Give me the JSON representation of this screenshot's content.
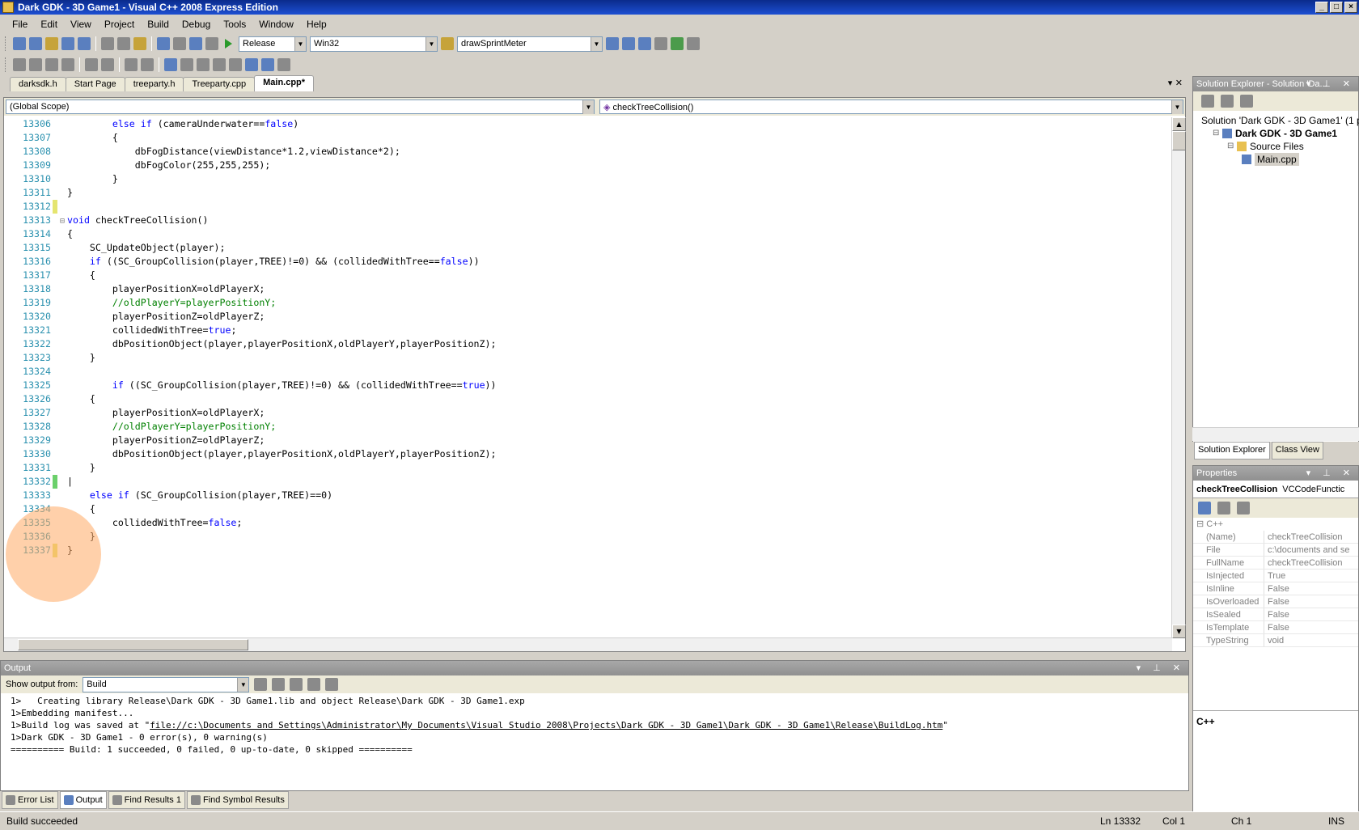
{
  "window": {
    "title": "Dark GDK - 3D Game1 - Visual C++ 2008 Express Edition"
  },
  "menu": [
    "File",
    "Edit",
    "View",
    "Project",
    "Build",
    "Debug",
    "Tools",
    "Window",
    "Help"
  ],
  "toolbar": {
    "config": "Release",
    "platform": "Win32",
    "find": "drawSprintMeter"
  },
  "tabs": [
    "darksdk.h",
    "Start Page",
    "treeparty.h",
    "Treeparty.cpp",
    "Main.cpp*"
  ],
  "editor": {
    "scope": "(Global Scope)",
    "member": "checkTreeCollision()",
    "lines": [
      {
        "n": "13306",
        "marg": "",
        "fold": "",
        "tokens": [
          [
            "",
            "        "
          ],
          [
            "kw",
            "else if"
          ],
          [
            "",
            " (cameraUnderwater=="
          ],
          [
            "kw",
            "false"
          ],
          [
            "",
            ")"
          ]
        ]
      },
      {
        "n": "13307",
        "marg": "",
        "fold": "",
        "tokens": [
          [
            "",
            "        {"
          ]
        ]
      },
      {
        "n": "13308",
        "marg": "",
        "fold": "",
        "tokens": [
          [
            "",
            "            dbFogDistance(viewDistance*1.2,viewDistance*2);"
          ]
        ]
      },
      {
        "n": "13309",
        "marg": "",
        "fold": "",
        "tokens": [
          [
            "",
            "            dbFogColor(255,255,255);"
          ]
        ]
      },
      {
        "n": "13310",
        "marg": "",
        "fold": "",
        "tokens": [
          [
            "",
            "        }"
          ]
        ]
      },
      {
        "n": "13311",
        "marg": "",
        "fold": "",
        "tokens": [
          [
            "",
            "}"
          ]
        ]
      },
      {
        "n": "13312",
        "marg": "y",
        "fold": "",
        "tokens": [
          [
            "",
            ""
          ]
        ]
      },
      {
        "n": "13313",
        "marg": "",
        "fold": "⊟",
        "tokens": [
          [
            "kw",
            "void"
          ],
          [
            "",
            " checkTreeCollision()"
          ]
        ]
      },
      {
        "n": "13314",
        "marg": "",
        "fold": "",
        "tokens": [
          [
            "",
            "{"
          ]
        ]
      },
      {
        "n": "13315",
        "marg": "",
        "fold": "",
        "tokens": [
          [
            "",
            "    SC_UpdateObject(player);"
          ]
        ]
      },
      {
        "n": "13316",
        "marg": "",
        "fold": "",
        "tokens": [
          [
            "",
            "    "
          ],
          [
            "kw",
            "if"
          ],
          [
            "",
            " ((SC_GroupCollision(player,TREE)!=0) && (collidedWithTree=="
          ],
          [
            "kw",
            "false"
          ],
          [
            "",
            "))"
          ]
        ]
      },
      {
        "n": "13317",
        "marg": "",
        "fold": "",
        "tokens": [
          [
            "",
            "    {"
          ]
        ]
      },
      {
        "n": "13318",
        "marg": "",
        "fold": "",
        "tokens": [
          [
            "",
            "        playerPositionX=oldPlayerX;"
          ]
        ]
      },
      {
        "n": "13319",
        "marg": "",
        "fold": "",
        "tokens": [
          [
            "",
            "        "
          ],
          [
            "cm",
            "//oldPlayerY=playerPositionY;"
          ]
        ]
      },
      {
        "n": "13320",
        "marg": "",
        "fold": "",
        "tokens": [
          [
            "",
            "        playerPositionZ=oldPlayerZ;"
          ]
        ]
      },
      {
        "n": "13321",
        "marg": "",
        "fold": "",
        "tokens": [
          [
            "",
            "        collidedWithTree="
          ],
          [
            "kw",
            "true"
          ],
          [
            "",
            ";"
          ]
        ]
      },
      {
        "n": "13322",
        "marg": "",
        "fold": "",
        "tokens": [
          [
            "",
            "        dbPositionObject(player,playerPositionX,oldPlayerY,playerPositionZ);"
          ]
        ]
      },
      {
        "n": "13323",
        "marg": "",
        "fold": "",
        "tokens": [
          [
            "",
            "    }"
          ]
        ]
      },
      {
        "n": "13324",
        "marg": "",
        "fold": "",
        "tokens": [
          [
            "",
            ""
          ]
        ]
      },
      {
        "n": "13325",
        "marg": "",
        "fold": "",
        "tokens": [
          [
            "",
            "        "
          ],
          [
            "kw",
            "if"
          ],
          [
            "",
            " ((SC_GroupCollision(player,TREE)!=0) && (collidedWithTree=="
          ],
          [
            "kw",
            "true"
          ],
          [
            "",
            "))"
          ]
        ]
      },
      {
        "n": "13326",
        "marg": "",
        "fold": "",
        "tokens": [
          [
            "",
            "    {"
          ]
        ]
      },
      {
        "n": "13327",
        "marg": "",
        "fold": "",
        "tokens": [
          [
            "",
            "        playerPositionX=oldPlayerX;"
          ]
        ]
      },
      {
        "n": "13328",
        "marg": "",
        "fold": "",
        "tokens": [
          [
            "",
            "        "
          ],
          [
            "cm",
            "//oldPlayerY=playerPositionY;"
          ]
        ]
      },
      {
        "n": "13329",
        "marg": "",
        "fold": "",
        "tokens": [
          [
            "",
            "        playerPositionZ=oldPlayerZ;"
          ]
        ]
      },
      {
        "n": "13330",
        "marg": "",
        "fold": "",
        "tokens": [
          [
            "",
            "        dbPositionObject(player,playerPositionX,oldPlayerY,playerPositionZ);"
          ]
        ]
      },
      {
        "n": "13331",
        "marg": "",
        "fold": "",
        "tokens": [
          [
            "",
            "    }"
          ]
        ]
      },
      {
        "n": "13332",
        "marg": "g",
        "fold": "",
        "tokens": [
          [
            "",
            "|"
          ]
        ]
      },
      {
        "n": "13333",
        "marg": "",
        "fold": "",
        "tokens": [
          [
            "",
            "    "
          ],
          [
            "kw",
            "else if"
          ],
          [
            "",
            " (SC_GroupCollision(player,TREE)==0)"
          ]
        ]
      },
      {
        "n": "13334",
        "marg": "",
        "fold": "",
        "tokens": [
          [
            "",
            "    {"
          ]
        ]
      },
      {
        "n": "13335",
        "marg": "",
        "fold": "",
        "tokens": [
          [
            "",
            "        collidedWithTree="
          ],
          [
            "kw",
            "false"
          ],
          [
            "",
            ";"
          ]
        ]
      },
      {
        "n": "13336",
        "marg": "",
        "fold": "",
        "tokens": [
          [
            "",
            "    }"
          ]
        ]
      },
      {
        "n": "13337",
        "marg": "y",
        "fold": "",
        "tokens": [
          [
            "",
            "}"
          ]
        ]
      }
    ]
  },
  "solution_explorer": {
    "title": "Solution Explorer - Solution 'Da...",
    "items": [
      {
        "label": "Solution 'Dark GDK - 3D Game1' (1 p",
        "indent": 0,
        "bold": false,
        "sel": false
      },
      {
        "label": "Dark GDK - 3D Game1",
        "indent": 1,
        "bold": true,
        "sel": false
      },
      {
        "label": "Source Files",
        "indent": 2,
        "bold": false,
        "sel": false
      },
      {
        "label": "Main.cpp",
        "indent": 3,
        "bold": false,
        "sel": true
      }
    ],
    "tabs": [
      "Solution Explorer",
      "Class View"
    ]
  },
  "properties": {
    "title": "Properties",
    "object_name": "checkTreeCollision",
    "object_type": "VCCodeFunctic",
    "category": "C++",
    "rows": [
      {
        "k": "(Name)",
        "v": "checkTreeCollision"
      },
      {
        "k": "File",
        "v": "c:\\documents and se"
      },
      {
        "k": "FullName",
        "v": "checkTreeCollision"
      },
      {
        "k": "IsInjected",
        "v": "True"
      },
      {
        "k": "IsInline",
        "v": "False"
      },
      {
        "k": "IsOverloaded",
        "v": "False"
      },
      {
        "k": "IsSealed",
        "v": "False"
      },
      {
        "k": "IsTemplate",
        "v": "False"
      },
      {
        "k": "TypeString",
        "v": "void"
      }
    ],
    "description": "C++"
  },
  "output": {
    "title": "Output",
    "show_from_label": "Show output from:",
    "show_from": "Build",
    "lines": [
      {
        "t": "1>   Creating library Release\\Dark GDK - 3D Game1.lib and object Release\\Dark GDK - 3D Game1.exp",
        "link": ""
      },
      {
        "t": "1>Embedding manifest...",
        "link": ""
      },
      {
        "t": "1>Build log was saved at \"",
        "link": "file://c:\\Documents and Settings\\Administrator\\My Documents\\Visual Studio 2008\\Projects\\Dark GDK - 3D Game1\\Dark GDK - 3D Game1\\Release\\BuildLog.htm",
        "post": "\""
      },
      {
        "t": "1>Dark GDK - 3D Game1 - 0 error(s), 0 warning(s)",
        "link": ""
      },
      {
        "t": "========== Build: 1 succeeded, 0 failed, 0 up-to-date, 0 skipped ==========",
        "link": ""
      }
    ]
  },
  "bottom_tabs": [
    "Error List",
    "Output",
    "Find Results 1",
    "Find Symbol Results"
  ],
  "status": {
    "text": "Build succeeded",
    "ln": "Ln 13332",
    "col": "Col 1",
    "ch": "Ch 1",
    "mode": "INS"
  }
}
